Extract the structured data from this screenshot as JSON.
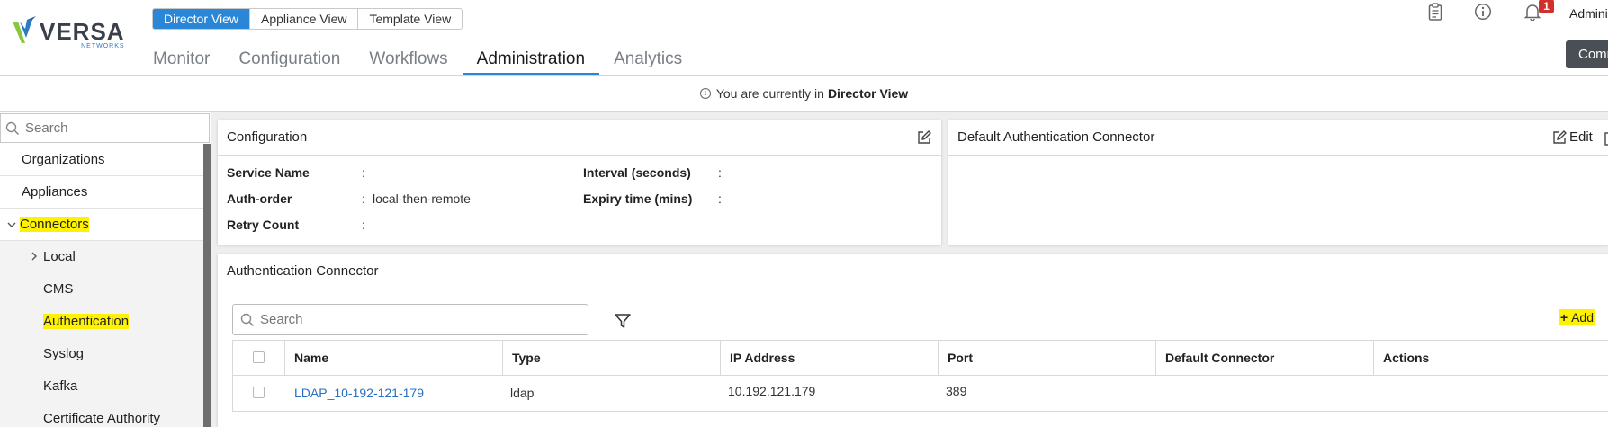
{
  "header": {
    "logo": {
      "word": "VERSA",
      "sub": "NETWORKS"
    },
    "view_switch": [
      "Director View",
      "Appliance View",
      "Template View"
    ],
    "main_tabs": [
      "Monitor",
      "Configuration",
      "Workflows",
      "Administration",
      "Analytics"
    ],
    "active_tab": "Administration",
    "notifications_count": "1",
    "user_label": "Adminis",
    "commit_label": "Commit Tem"
  },
  "infobar": {
    "prefix": "You are currently in",
    "view": "Director View"
  },
  "sidebar": {
    "search_placeholder": "Search",
    "items": [
      "Organizations",
      "Appliances",
      "Connectors"
    ],
    "sub_items": [
      "Local",
      "CMS",
      "Authentication",
      "Syslog",
      "Kafka",
      "Certificate Authority"
    ]
  },
  "config_panel": {
    "title": "Configuration",
    "fields": [
      {
        "label": "Service Name",
        "value": ""
      },
      {
        "label": "Auth-order",
        "value": "local-then-remote"
      },
      {
        "label": "Retry Count",
        "value": ""
      },
      {
        "label": "Interval (seconds)",
        "value": ""
      },
      {
        "label": "Expiry time (mins)",
        "value": ""
      }
    ]
  },
  "default_panel": {
    "title": "Default Authentication Connector",
    "edit_label": "Edit"
  },
  "auth_panel": {
    "title": "Authentication Connector",
    "search_placeholder": "Search",
    "add_label": "Add",
    "columns": [
      "Name",
      "Type",
      "IP Address",
      "Port",
      "Default Connector",
      "Actions"
    ],
    "rows": [
      {
        "name": "LDAP_10-192-121-179",
        "type": "ldap",
        "ip": "10.192.121.179",
        "port": "389",
        "default": "",
        "actions": ""
      }
    ]
  },
  "colors": {
    "accent": "#2a86d6",
    "highlight": "#fff200",
    "link": "#2a6fc2"
  }
}
